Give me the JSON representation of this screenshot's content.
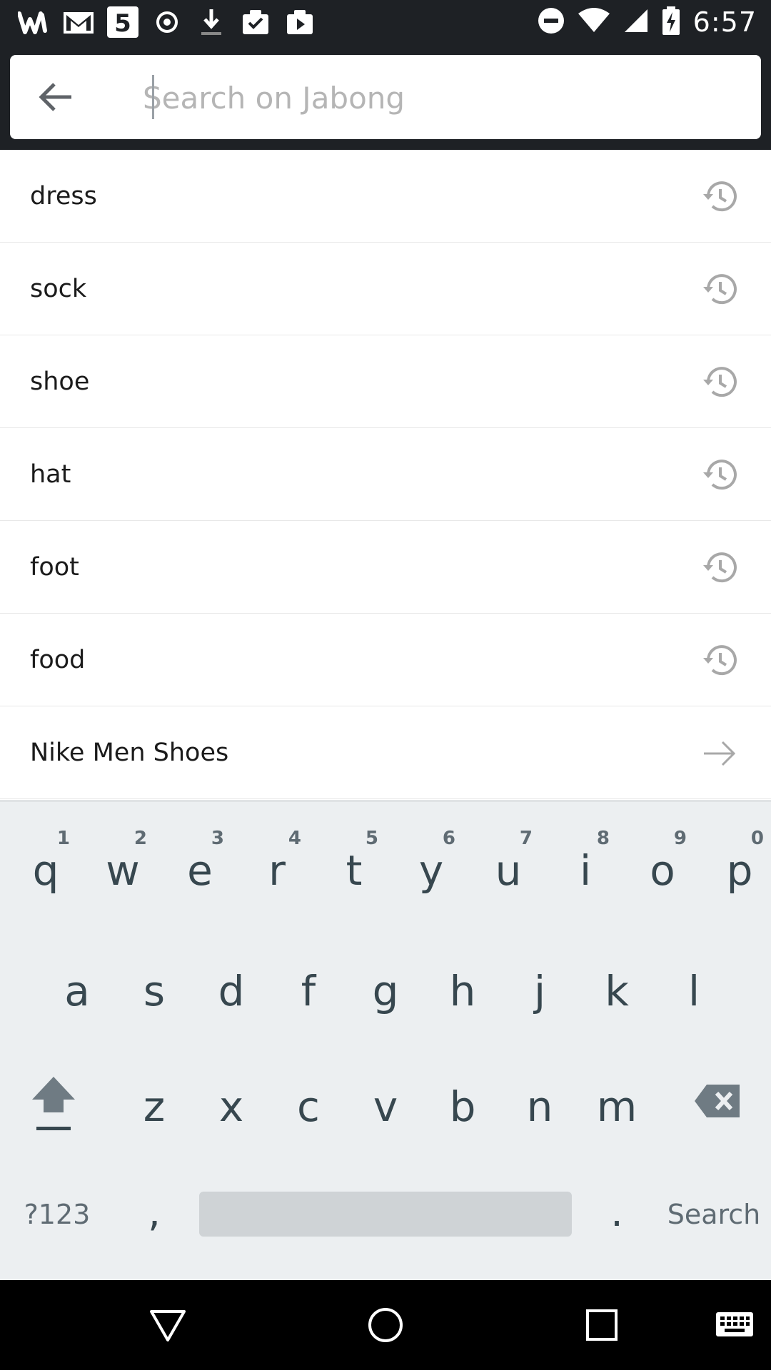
{
  "status_bar": {
    "time": "6:57",
    "left_icons": [
      "wattpad-icon",
      "gmail-icon",
      "app-5-icon",
      "record-icon",
      "download-icon",
      "clipboard-icon",
      "play-store-icon"
    ],
    "right_icons": [
      "do-not-disturb-icon",
      "wifi-icon",
      "signal-icon",
      "battery-charging-icon"
    ]
  },
  "search": {
    "placeholder": "Search on Jabong",
    "value": ""
  },
  "suggestions": [
    {
      "label": "dress",
      "icon": "history-icon"
    },
    {
      "label": "sock",
      "icon": "history-icon"
    },
    {
      "label": "shoe",
      "icon": "history-icon"
    },
    {
      "label": "hat",
      "icon": "history-icon"
    },
    {
      "label": "foot",
      "icon": "history-icon"
    },
    {
      "label": "food",
      "icon": "history-icon"
    },
    {
      "label": "Nike Men Shoes",
      "icon": "arrow-right-icon"
    }
  ],
  "keyboard": {
    "row1": [
      {
        "ch": "q",
        "hint": "1"
      },
      {
        "ch": "w",
        "hint": "2"
      },
      {
        "ch": "e",
        "hint": "3"
      },
      {
        "ch": "r",
        "hint": "4"
      },
      {
        "ch": "t",
        "hint": "5"
      },
      {
        "ch": "y",
        "hint": "6"
      },
      {
        "ch": "u",
        "hint": "7"
      },
      {
        "ch": "i",
        "hint": "8"
      },
      {
        "ch": "o",
        "hint": "9"
      },
      {
        "ch": "p",
        "hint": "0"
      }
    ],
    "row2": [
      "a",
      "s",
      "d",
      "f",
      "g",
      "h",
      "j",
      "k",
      "l"
    ],
    "row3": [
      "z",
      "x",
      "c",
      "v",
      "b",
      "n",
      "m"
    ],
    "symbols_label": "?123",
    "comma": ",",
    "period": ".",
    "action_label": "Search"
  },
  "nav_bar": {
    "icons": [
      "back-triangle-icon",
      "home-circle-icon",
      "recents-square-icon",
      "keyboard-switch-icon"
    ]
  },
  "colors": {
    "status_bar_bg": "#1e2125",
    "keyboard_bg": "#eceff1",
    "key_text": "#37474f",
    "history_icon": "#a8a8a8"
  }
}
